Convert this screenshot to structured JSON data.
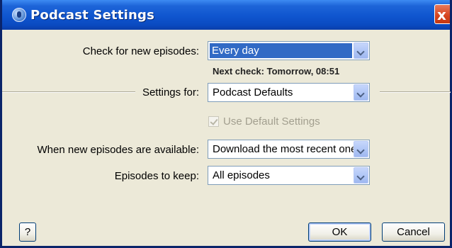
{
  "window": {
    "title": "Podcast Settings",
    "close_glyph": "x"
  },
  "check_episodes": {
    "label": "Check for new episodes:",
    "value": "Every day",
    "next_check": "Next check: Tomorrow, 08:51"
  },
  "settings_for": {
    "label": "Settings for:",
    "value": "Podcast Defaults"
  },
  "use_default": {
    "label": "Use Default Settings",
    "checked": true,
    "enabled": false
  },
  "new_episodes": {
    "label": "When new episodes are available:",
    "value": "Download the most recent one"
  },
  "episodes_keep": {
    "label": "Episodes to keep:",
    "value": "All episodes"
  },
  "buttons": {
    "help": "?",
    "ok": "OK",
    "cancel": "Cancel"
  },
  "colors": {
    "titlebar": "#0f55cf",
    "selection": "#316ac5",
    "dialog_bg": "#ece9d8"
  }
}
